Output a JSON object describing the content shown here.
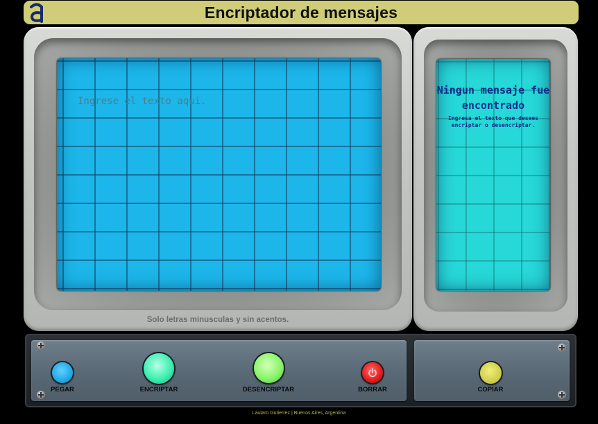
{
  "header": {
    "title": "Encriptador de mensajes",
    "logo_letter": "a"
  },
  "input": {
    "placeholder": "Ingrese el texto aqui.",
    "value": ""
  },
  "hint": "Solo letras minusculas y sin acentos.",
  "output": {
    "empty_title": "Ningun mensaje fue encontrado",
    "empty_subtitle": "Ingresa el texto que desees encriptar o desencriptar."
  },
  "buttons": {
    "pegar": "PEGAR",
    "encriptar": "ENCRIPTAR",
    "desencriptar": "DESENCRIPTAR",
    "borrar": "BORRAR",
    "copiar": "COPIAR"
  },
  "footer": "Lautaro Gutierrez | Buenos Aires, Argentina",
  "colors": {
    "header_bg": "#cfcd78",
    "screen_left": "#1cb6ea",
    "screen_right": "#27d8d8",
    "pegar": "#1aa0e0",
    "encriptar": "#3df0b0",
    "desencriptar": "#8af56b",
    "borrar": "#e01b1b",
    "copiar": "#cdcc4a"
  }
}
